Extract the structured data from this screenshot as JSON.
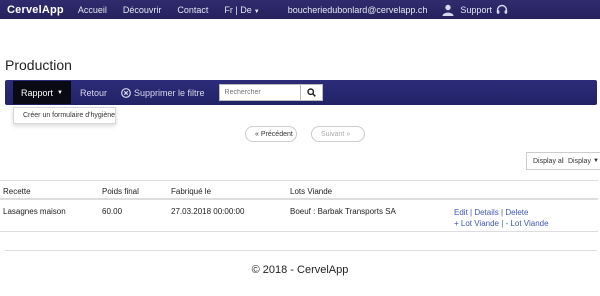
{
  "nav": {
    "brand": "CervelApp",
    "links": [
      "Accueil",
      "Découvrir",
      "Contact"
    ],
    "language": "Fr | De",
    "email": "boucheriedubonlard@cervelapp.ch",
    "support": "Support",
    "bg_color": "#2f2c6e"
  },
  "page": {
    "title": "Production"
  },
  "toolbar": {
    "rapport": "Rapport",
    "retour": "Retour",
    "clear_filter": "Supprimer le filtre",
    "search_placeholder": "Rechercher",
    "bg_color": "#26236a"
  },
  "dropdown": {
    "item": "Créer un formulaire d'hygiène"
  },
  "pager": {
    "prev": "Précédent",
    "next": "Suivant"
  },
  "display": {
    "all": "Display all",
    "display": "Display"
  },
  "table": {
    "headers": [
      "Recette",
      "Poids final",
      "Fabriqué le",
      "Lots Viande"
    ],
    "rows": [
      {
        "recette": "Lasagnes maison",
        "poids": "60.00",
        "fabrique": "27.03.2018 00:00:00",
        "lots": "Boeuf : Barbak Transports SA",
        "action_edit": "Edit",
        "action_details": "Details",
        "action_delete": "Delete",
        "action_lot_plus": "+ Lot Viande",
        "action_lot_minus": "- Lot Viande"
      }
    ]
  },
  "footer": "© 2018 - CervelApp"
}
